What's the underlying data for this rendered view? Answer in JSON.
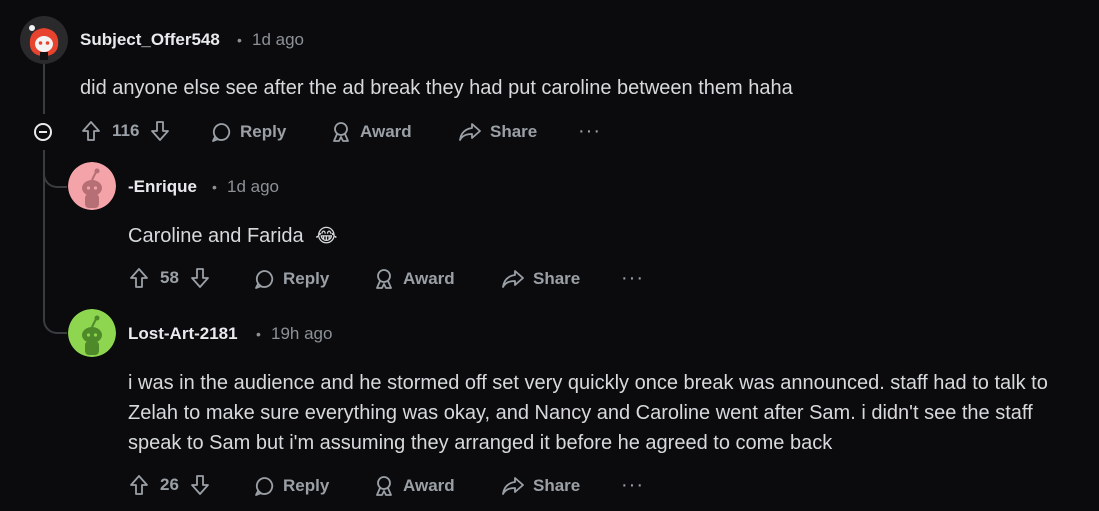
{
  "comments": [
    {
      "author": "Subject_Offer548",
      "time": "1d ago",
      "body": "did anyone else see after the ad break they had put caroline between them haha",
      "votes": "116",
      "avatar_color": "#e8432f"
    },
    {
      "author": "-Enrique",
      "time": "1d ago",
      "body": "Caroline and Farida",
      "emoji": "😂",
      "votes": "58",
      "avatar_color": "#f4a3a9"
    },
    {
      "author": "Lost-Art-2181",
      "time": "19h ago",
      "body_lines": [
        "i was in the audience and he stormed off set very quickly once break was announced. staff had to talk to",
        "Zelah to make sure everything was okay, and Nancy and Caroline went after Sam. i didn't see the staff",
        "speak to Sam but i'm assuming they arranged it before he agreed to come back"
      ],
      "votes": "26",
      "avatar_color": "#8ed64f"
    }
  ],
  "actions": {
    "reply": "Reply",
    "award": "Award",
    "share": "Share",
    "more": "···",
    "separator": "•"
  }
}
